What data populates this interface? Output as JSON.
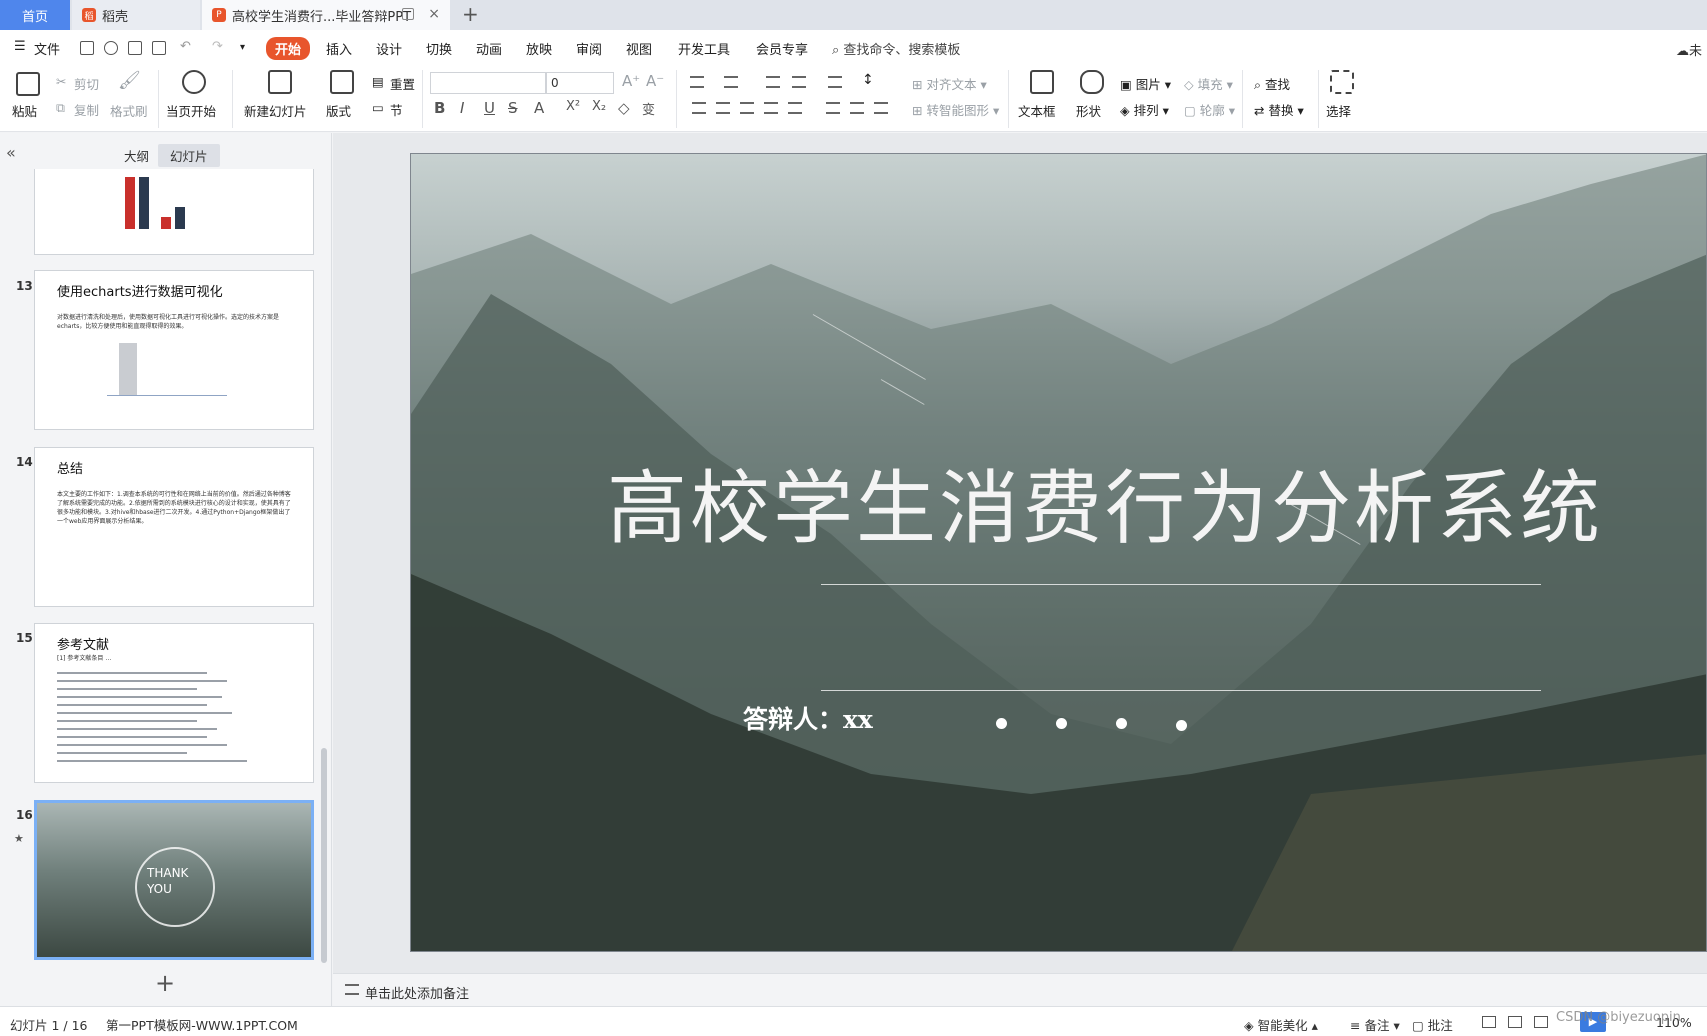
{
  "tabs": {
    "home": "首页",
    "daoke": "稻壳",
    "doc": "高校学生消费行...毕业答辩PPT"
  },
  "menu": {
    "file": "文件",
    "items": [
      "开始",
      "插入",
      "设计",
      "切换",
      "动画",
      "放映",
      "审阅",
      "视图",
      "开发工具",
      "会员专享"
    ],
    "search": "查找命令、搜索模板",
    "cloud": "未"
  },
  "ribbon": {
    "paste": "粘贴",
    "cut": "剪切",
    "copy": "复制",
    "format_painter": "格式刷",
    "play_current": "当页开始",
    "new_slide": "新建幻灯片",
    "layout": "版式",
    "reset": "重置",
    "section": "节",
    "font_size": "0",
    "align_text": "对齐文本",
    "smartart": "转智能图形",
    "textbox": "文本框",
    "shape": "形状",
    "picture": "图片",
    "arrange": "排列",
    "fill": "填充",
    "outline": "轮廓",
    "find": "查找",
    "replace": "替换",
    "select": "选择"
  },
  "panel": {
    "tab_outline": "大纲",
    "tab_slides": "幻灯片",
    "collapse": "«",
    "add": "+"
  },
  "thumbnails": [
    {
      "num": "13",
      "title": "使用echarts进行数据可视化",
      "text": "对数据进行清洗和处理后，使用数据可视化工具进行可视化操作。选定的技术方案是echarts，比较方便使用和能直观得取得的效果。"
    },
    {
      "num": "14",
      "title": "总结",
      "text": "本文主要的工作如下：1.调查本系统的可行性和在网络上当前的价值。然后通过各种博客了解系统需要完成的功能。2.依据所需到的系统模块进行核心的设计和实现，使其具有了很多功能和模块。3.对hive和hbase进行二次开发。4.通过Python+Django框架做出了一个web应用界面展示分析结果。"
    },
    {
      "num": "15",
      "title": "参考文献",
      "text": "[1] 参考文献条目 …"
    },
    {
      "num": "16",
      "title": "",
      "text": "THANK YOU"
    }
  ],
  "slide": {
    "title": "高校学生消费行为分析系统",
    "presenter": "答辩人：xx"
  },
  "notes": {
    "placeholder": "单击此处添加备注"
  },
  "status": {
    "slide_info": "幻灯片 1 / 16",
    "template": "第一PPT模板网-WWW.1PPT.COM",
    "beautify": "智能美化",
    "notes": "备注",
    "comment": "批注",
    "zoom": "110%",
    "watermark": "CSDN @biyezuopin"
  },
  "colors": {
    "accent": "#e8552c",
    "home_tab": "#4f86ec",
    "selection": "#7bb0f5"
  }
}
